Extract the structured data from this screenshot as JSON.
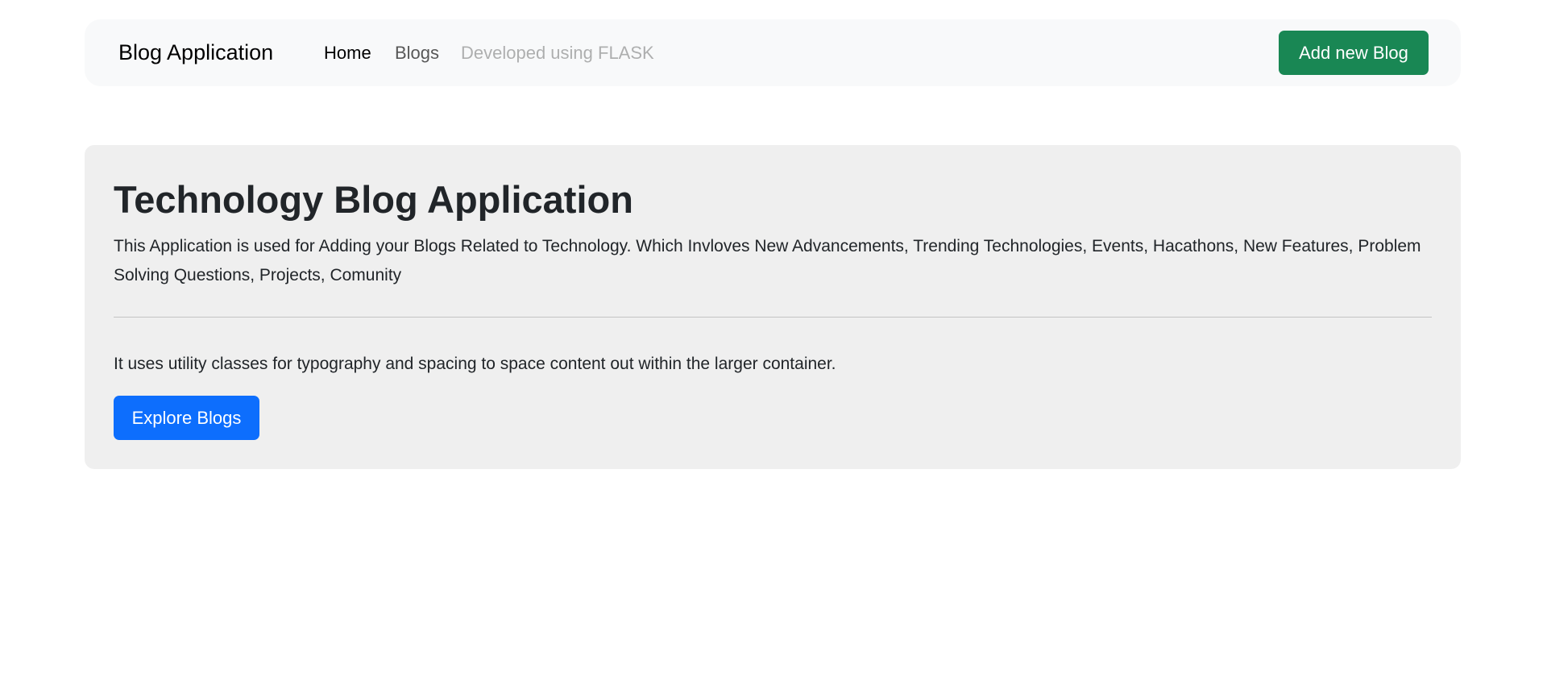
{
  "navbar": {
    "brand": "Blog Application",
    "links": [
      {
        "label": "Home"
      },
      {
        "label": "Blogs"
      },
      {
        "label": "Developed using FLASK"
      }
    ],
    "add_button": "Add new Blog"
  },
  "hero": {
    "title": "Technology Blog Application",
    "description": "This Application is used for Adding your Blogs Related to Technology. Which Invloves New Advancements, Trending Technologies, Events, Hacathons, New Features, Problem Solving Questions, Projects, Comunity",
    "secondary_text": "It uses utility classes for typography and spacing to space content out within the larger container.",
    "explore_button": "Explore Blogs"
  },
  "colors": {
    "primary": "#0d6efd",
    "success": "#198754",
    "navbar_bg": "#f8f9fa",
    "hero_bg": "#efefef"
  }
}
